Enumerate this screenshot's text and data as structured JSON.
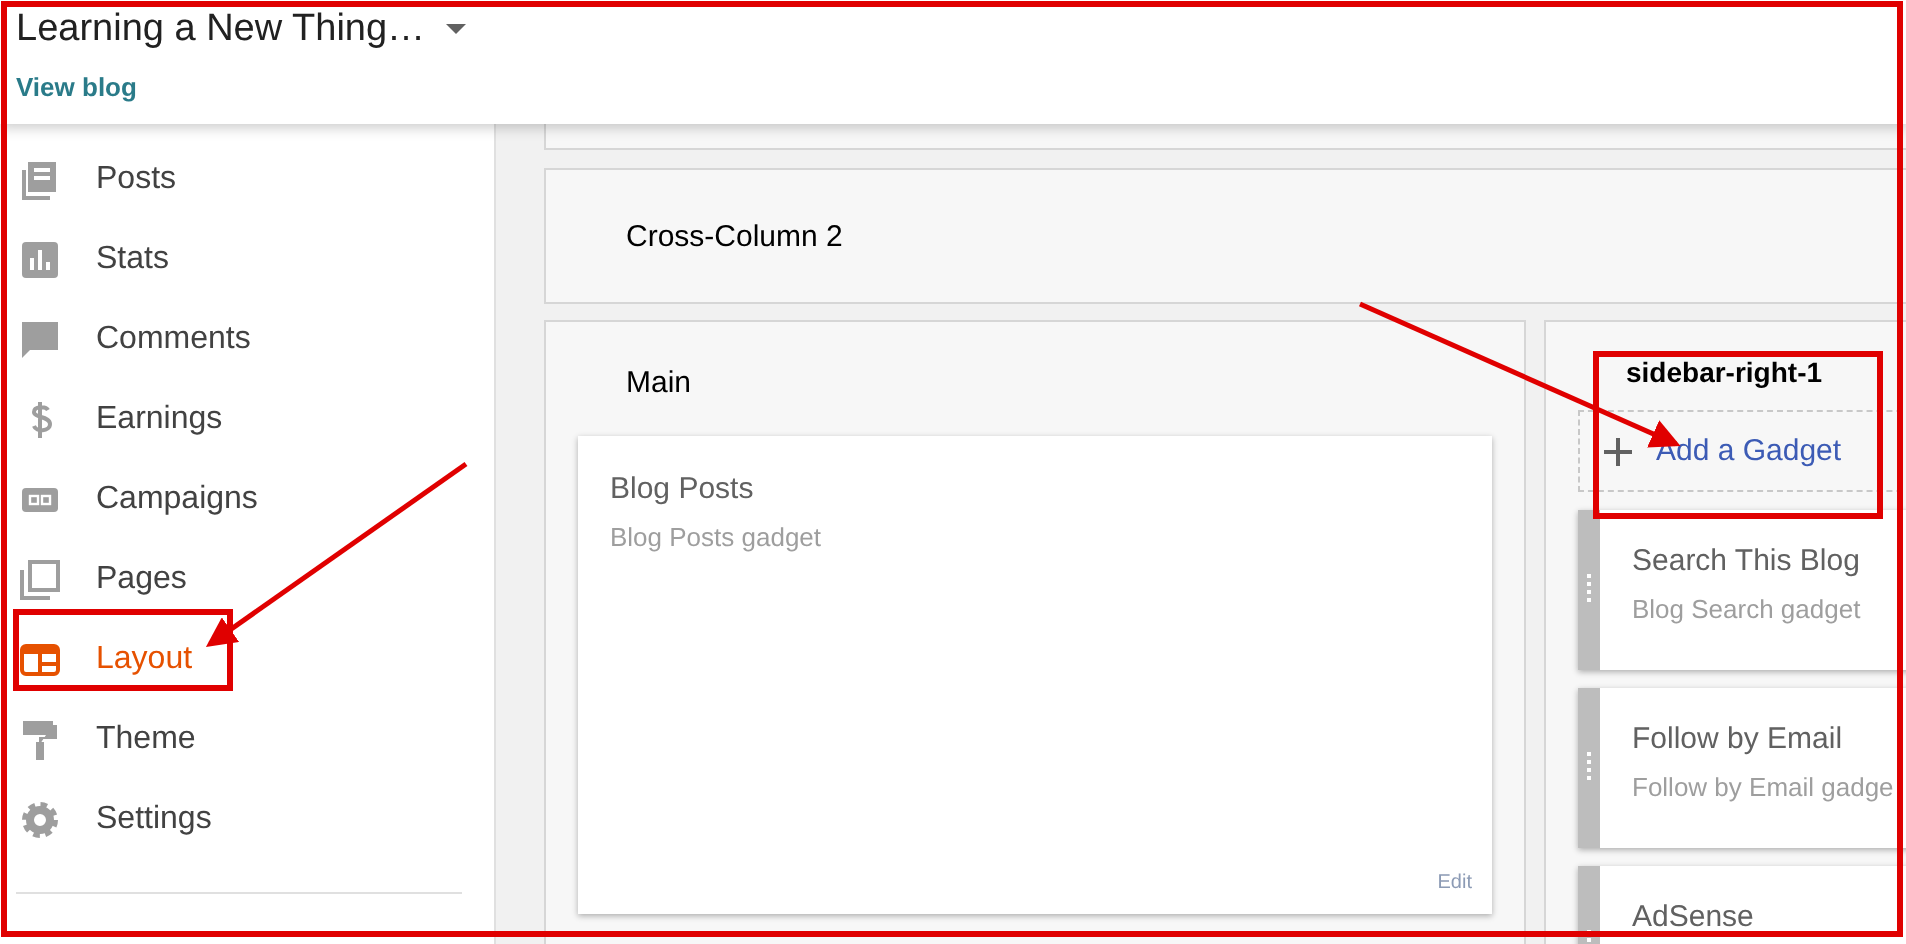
{
  "header": {
    "blog_title": "Learning a New Thing…",
    "view_blog_link": "View blog"
  },
  "sidebar": {
    "items": [
      {
        "label": "Posts",
        "kind": "posts",
        "selected": false
      },
      {
        "label": "Stats",
        "kind": "stats",
        "selected": false
      },
      {
        "label": "Comments",
        "kind": "comments",
        "selected": false
      },
      {
        "label": "Earnings",
        "kind": "earnings",
        "selected": false
      },
      {
        "label": "Campaigns",
        "kind": "campaigns",
        "selected": false
      },
      {
        "label": "Pages",
        "kind": "pages",
        "selected": false
      },
      {
        "label": "Layout",
        "kind": "layout",
        "selected": true
      },
      {
        "label": "Theme",
        "kind": "theme",
        "selected": false
      },
      {
        "label": "Settings",
        "kind": "settings",
        "selected": false
      }
    ]
  },
  "layout": {
    "cross_column": {
      "title": "Cross-Column 2"
    },
    "main": {
      "title": "Main",
      "gadgets": [
        {
          "title": "Blog Posts",
          "subtitle": "Blog Posts gadget",
          "action": "Edit"
        }
      ]
    },
    "sidebar_right": {
      "title": "sidebar-right-1",
      "add_gadget": "Add a Gadget",
      "gadgets": [
        {
          "title": "Search This Blog",
          "subtitle": "Blog Search gadget"
        },
        {
          "title": "Follow by Email",
          "subtitle": "Follow by Email gadge"
        },
        {
          "title": "AdSense"
        }
      ]
    }
  }
}
